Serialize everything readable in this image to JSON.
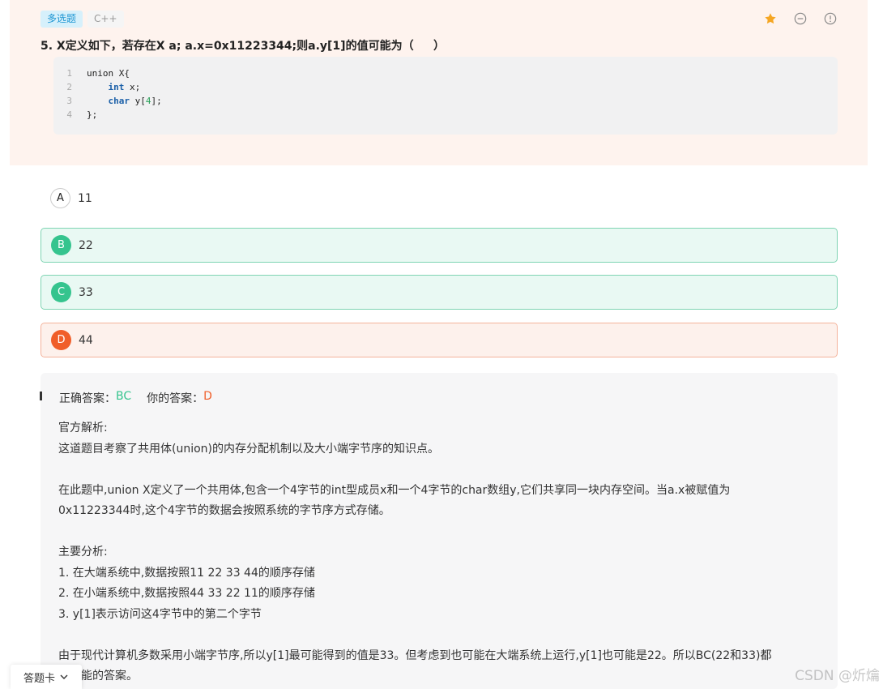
{
  "question": {
    "type_tag": "多选题",
    "lang_tag": "C++",
    "title": "5. X定义如下，若存在X a; a.x=0x11223344;则a.y[1]的值可能为（     ）",
    "icons": [
      "star-icon",
      "minus-circle-icon",
      "info-circle-icon"
    ],
    "code": {
      "line_numbers": [
        "1",
        "2",
        "3",
        "4"
      ],
      "line1": "union X{",
      "line2_kw": "int",
      "line2_rest": " x;",
      "line3_kw": "char",
      "line3_pre": " y[",
      "line3_num": "4",
      "line3_post": "];",
      "line4": "};"
    }
  },
  "options": [
    {
      "letter": "A",
      "text": "11",
      "state": "unselected"
    },
    {
      "letter": "B",
      "text": "22",
      "state": "correct"
    },
    {
      "letter": "C",
      "text": "33",
      "state": "correct"
    },
    {
      "letter": "D",
      "text": "44",
      "state": "wrong"
    }
  ],
  "analysis": {
    "correct_label": "正确答案：",
    "correct_value": "BC",
    "your_label": "你的答案：",
    "your_value": "D",
    "heading": "官方解析:",
    "p1": "这道题目考察了共用体(union)的内存分配机制以及大小端字节序的知识点。",
    "p2a": "在此题中,union X定义了一个共用体,包含一个4字节的int型成员x和一个4字节的char数组y,它们共享同一块内存空间。当a.x被赋值为",
    "p2b": "0x11223344时,这个4字节的数据会按照系统的字节序方式存储。",
    "main_heading": "主要分析:",
    "point1": "1. 在大端系统中,数据按照11 22 33 44的顺序存储",
    "point2": "2. 在小端系统中,数据按照44 33 22 11的顺序存储",
    "point3": "3. y[1]表示访问这4字节中的第二个字节",
    "p3a": "由于现代计算机多数采用小端字节序,所以y[1]最可能得到的值是33。但考虑到也可能在大端系统上运行,y[1]也可能是22。所以BC(22和33)都",
    "p3b": "是可能的答案。"
  },
  "answer_card": {
    "label": "答题卡"
  },
  "watermark": "CSDN @炘爚",
  "colors": {
    "correct": "#35c48e",
    "wrong": "#f05e29",
    "panel": "#fef3ee",
    "tag": "#1f96d3"
  }
}
